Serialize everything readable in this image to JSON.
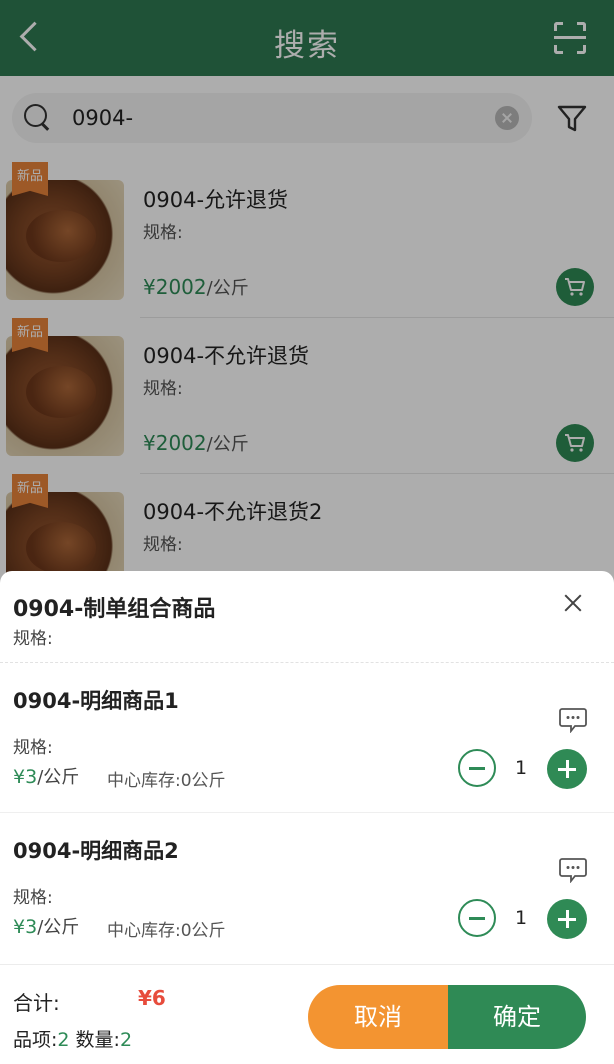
{
  "header": {
    "title": "搜索"
  },
  "search": {
    "value": "0904-"
  },
  "products": [
    {
      "badge": "新品",
      "name": "0904-允许退货",
      "spec": "规格:",
      "price": "¥2002",
      "unit": "/公斤"
    },
    {
      "badge": "新品",
      "name": "0904-不允许退货",
      "spec": "规格:",
      "price": "¥2002",
      "unit": "/公斤"
    },
    {
      "badge": "新品",
      "name": "0904-不允许退货2",
      "spec": "规格:",
      "price": "",
      "unit": ""
    }
  ],
  "sheet": {
    "title": "0904-制单组合商品",
    "spec": "规格:",
    "details": [
      {
        "name": "0904-明细商品1",
        "spec": "规格:",
        "price": "¥3",
        "unit": "/公斤",
        "stock": "中心库存:0公斤",
        "qty": "1"
      },
      {
        "name": "0904-明细商品2",
        "spec": "规格:",
        "price": "¥3",
        "unit": "/公斤",
        "stock": "中心库存:0公斤",
        "qty": "1"
      }
    ],
    "footer": {
      "total_label": "合计:",
      "total_value": "¥6",
      "items_label": "品项:",
      "items_value": "2",
      "qty_label": "数量:",
      "qty_value": "2",
      "cancel_label": "取消",
      "confirm_label": "确定"
    }
  },
  "colors": {
    "brand_green": "#2f7a52",
    "price_green": "#2e8b57",
    "accent_orange": "#f39431",
    "total_red": "#e74c3c"
  }
}
